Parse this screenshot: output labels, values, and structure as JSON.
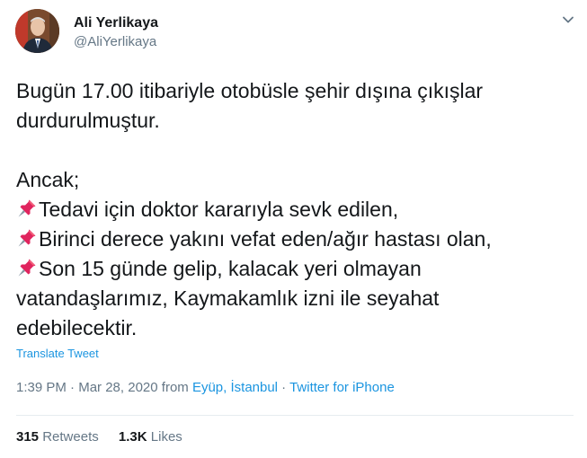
{
  "author": {
    "name": "Ali Yerlikaya",
    "handle": "@AliYerlikaya"
  },
  "tweet": {
    "line1": "Bugün 17.00 itibariyle otobüsle şehir dışına çıkışlar",
    "line2": "durdurulmuştur.",
    "line3": "Ancak;",
    "line4": "Tedavi için doktor kararıyla sevk edilen,",
    "line5": "Birinci derece yakını vefat eden/ağır hastası olan,",
    "line6": "Son 15 günde gelip, kalacak yeri olmayan",
    "line7": "vatandaşlarımız, Kaymakamlık izni ile seyahat",
    "line8": "edebilecektir.",
    "bullet_icon": "pushpin-icon"
  },
  "translate_label": "Translate Tweet",
  "meta": {
    "time": "1:39 PM",
    "separator1": " · ",
    "date": "Mar 28, 2020",
    "from": " from ",
    "location": "Eyüp, İstanbul",
    "separator2": " · ",
    "source": "Twitter for iPhone"
  },
  "stats": {
    "retweets_count": "315",
    "retweets_label": "Retweets",
    "likes_count": "1.3K",
    "likes_label": "Likes"
  },
  "colors": {
    "link": "#1b95e0",
    "muted": "#657786",
    "text": "#14171a",
    "pin": "#e0245e"
  }
}
